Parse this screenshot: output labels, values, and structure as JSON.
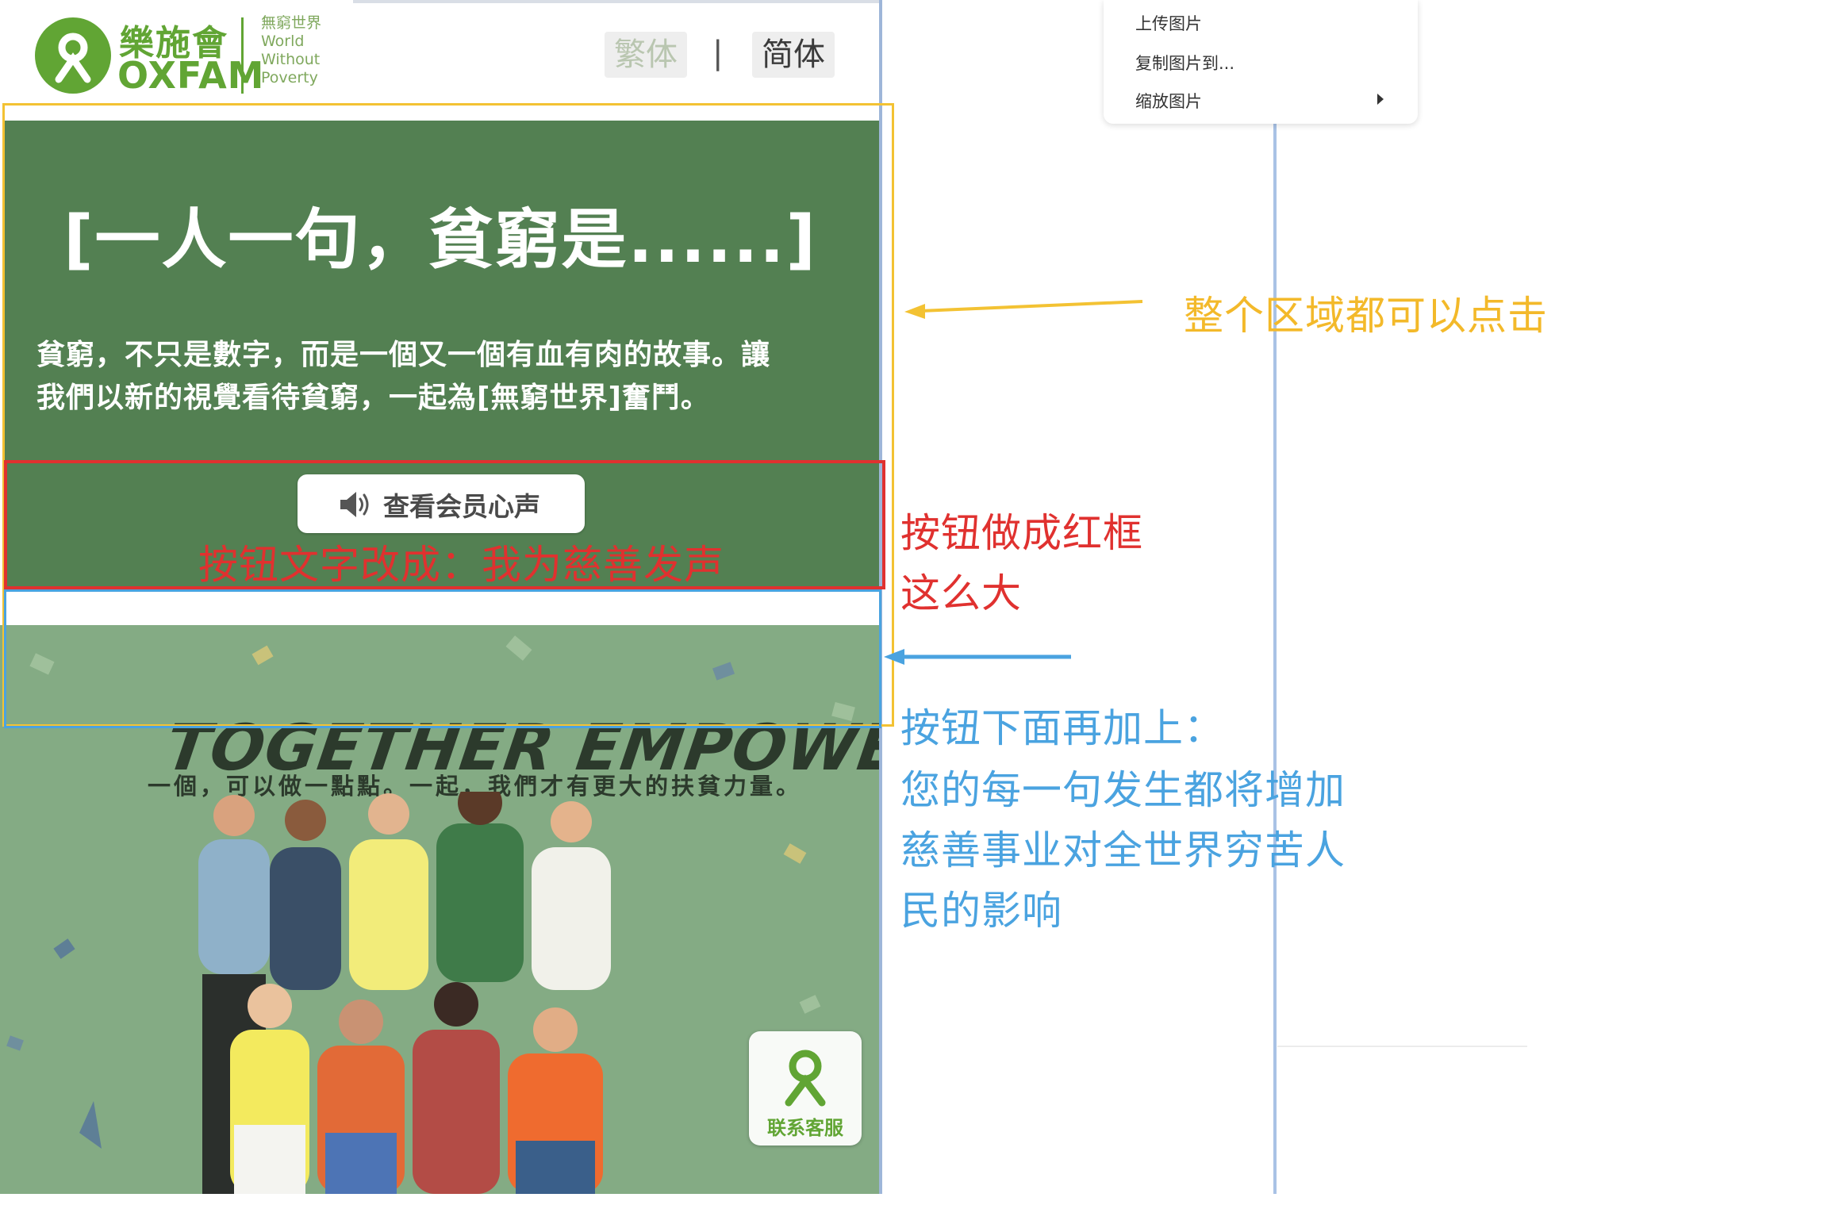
{
  "header": {
    "logo": {
      "name_cn": "樂施會",
      "name_en": "OXFAM",
      "tagline": "無窮世界\nWorld\nWithout\nPoverty"
    },
    "lang_traditional": "繁体",
    "lang_separator": "|",
    "lang_simplified": "简体"
  },
  "hero": {
    "title": "[一人一句，貧窮是......]",
    "desc_line1": "貧窮，不只是數字，而是一個又一個有血有肉的故事。讓",
    "desc_line2": "我們以新的視覺看待貧窮，一起為[無窮世界]奮鬥。",
    "button_label": "查看会员心声"
  },
  "banner": {
    "title": "TOGETHER EMPOWER!",
    "subtitle": "一個，可以做一點點。一起，我們才有更大的扶貧力量。"
  },
  "service_button": {
    "label": "联系客服"
  },
  "context_menu": {
    "items": [
      "上传图片",
      "复制图片到...",
      "缩放图片"
    ]
  },
  "annotations": {
    "inline_red": "按钮文字改成：我为慈善发声",
    "yellow": "整个区域都可以点击",
    "red_line1": "按钮做成红框",
    "red_line2": "这么大",
    "blue_line1": "按钮下面再加上：",
    "blue_line2": "您的每一句发生都将增加",
    "blue_line3": "慈善事业对全世界穷苦人",
    "blue_line4": "民的影响"
  },
  "colors": {
    "oxfam_green": "#61a534",
    "hero_green": "#538052",
    "banner_green": "#84ab84",
    "annotation_yellow": "#f3c233",
    "annotation_red": "#e0312f",
    "annotation_blue": "#4aa3e0"
  }
}
